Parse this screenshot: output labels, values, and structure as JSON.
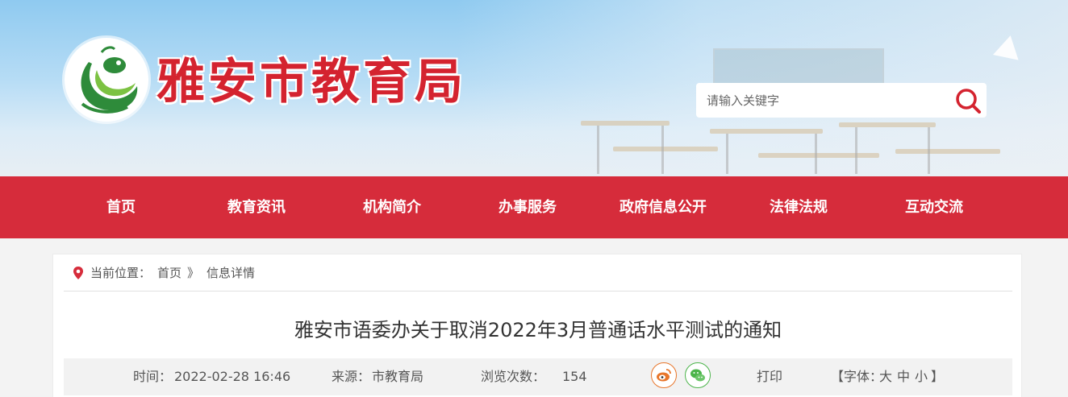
{
  "header": {
    "site_name": "雅安市教育局",
    "search_placeholder": "请输入关键字"
  },
  "nav": {
    "items": [
      "首页",
      "教育资讯",
      "机构简介",
      "办事服务",
      "政府信息公开",
      "法律法规",
      "互动交流"
    ]
  },
  "breadcrumb": {
    "prefix": "当前位置：",
    "home": "首页",
    "separator": "》",
    "current": "信息详情"
  },
  "article": {
    "title": "雅安市语委办关于取消2022年3月普通话水平测试的通知",
    "time_label": "时间：",
    "time_value": "2022-02-28 16:46",
    "source_label": "来源：",
    "source_value": "市教育局",
    "views_label": "浏览次数：",
    "views_value": "154",
    "print": "打印",
    "font_open": "【字体：",
    "font_large": "大",
    "font_medium": "中",
    "font_small": "小",
    "font_close": "】"
  },
  "colors": {
    "nav_bg": "#d62c3b",
    "brand_red": "#d4232f",
    "weibo": "#e8762b",
    "wechat": "#4bb44a"
  },
  "icons": [
    "logo-emblem",
    "search-icon",
    "location-pin-icon",
    "weibo-icon",
    "wechat-icon"
  ]
}
